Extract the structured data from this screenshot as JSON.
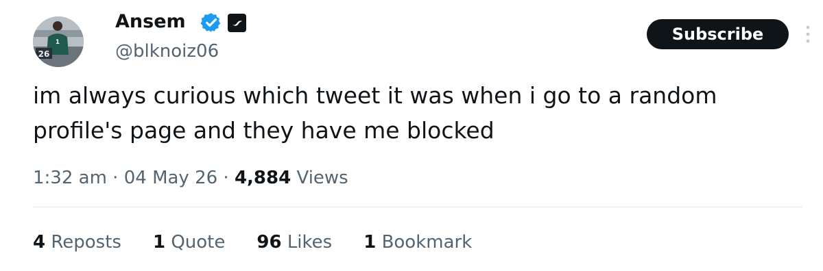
{
  "author": {
    "display_name": "Ansem",
    "handle": "@blknoiz06",
    "avatar_jersey_number": "26",
    "verified_icon": "verified-check-icon",
    "affiliate_icon": "affiliate-badge-icon"
  },
  "actions": {
    "subscribe_label": "Subscribe",
    "more_icon": "more-vertical-icon"
  },
  "tweet": {
    "text": "im always curious which tweet it was when i go to a random profile's page and they have me blocked"
  },
  "meta": {
    "time": "1:32 am",
    "separator": " · ",
    "date": "04 May 26",
    "views_count": "4,884",
    "views_label": "Views"
  },
  "stats": [
    {
      "count": "4",
      "label": "Reposts"
    },
    {
      "count": "1",
      "label": "Quote"
    },
    {
      "count": "96",
      "label": "Likes"
    },
    {
      "count": "1",
      "label": "Bookmark"
    }
  ],
  "colors": {
    "text_primary": "#0f1419",
    "text_secondary": "#536471",
    "verified_blue": "#1d9bf0",
    "divider": "#e4e8eb"
  }
}
